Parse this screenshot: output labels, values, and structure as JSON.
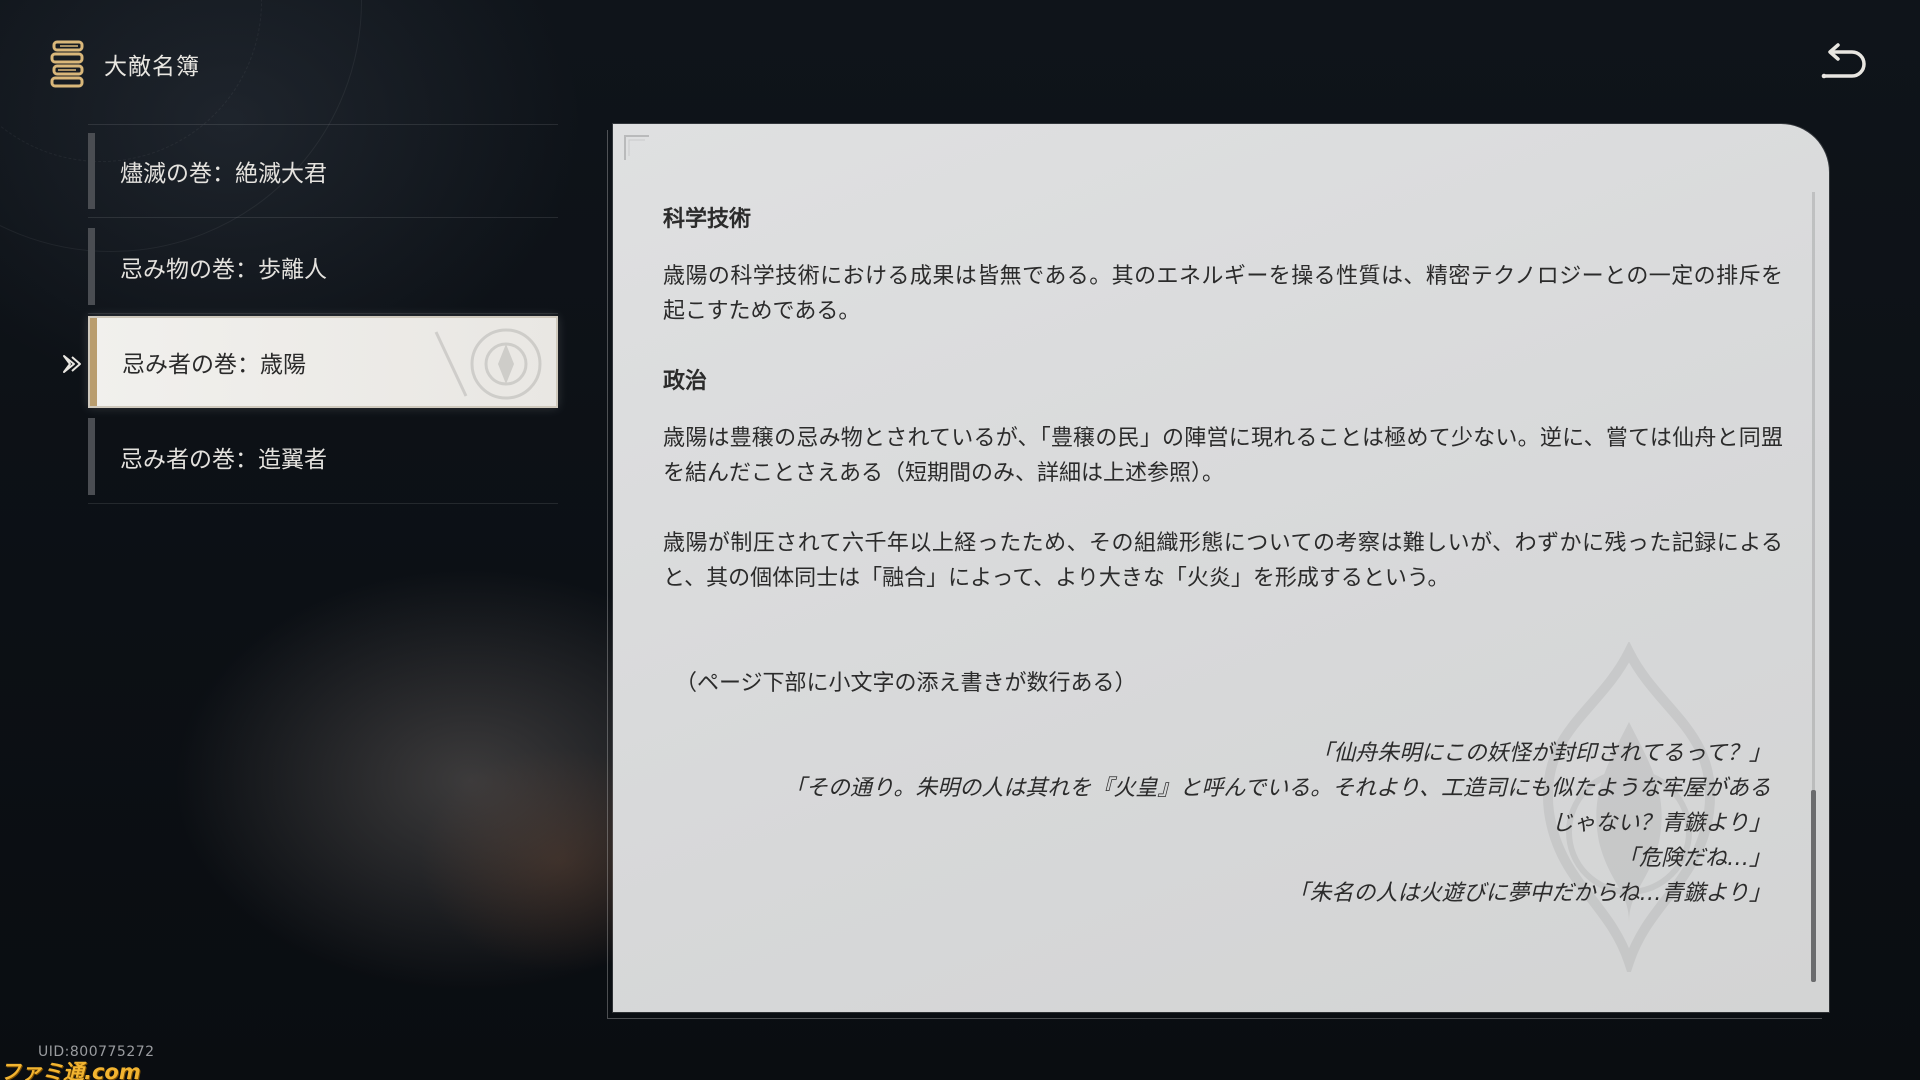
{
  "header": {
    "title": "大敵名簿",
    "book_icon": "book-icon",
    "back_icon": "back-arrow-icon"
  },
  "sidebar": {
    "items": [
      {
        "label": "燼滅の巻：絶滅大君",
        "active": false
      },
      {
        "label": "忌み物の巻：歩離人",
        "active": false
      },
      {
        "label": "忌み者の巻：歳陽",
        "active": true
      },
      {
        "label": "忌み者の巻：造翼者",
        "active": false
      }
    ]
  },
  "content": {
    "sections": [
      {
        "heading": "科学技術",
        "paragraphs": [
          "歳陽の科学技術における成果は皆無である。其のエネルギーを操る性質は、精密テクノロジーとの一定の排斥を起こすためである。"
        ]
      },
      {
        "heading": "政治",
        "paragraphs": [
          "歳陽は豊穣の忌み物とされているが、「豊穣の民」の陣営に現れることは極めて少ない。逆に、嘗ては仙舟と同盟を結んだことさえある（短期間のみ、詳細は上述参照）。",
          "歳陽が制圧されて六千年以上経ったため、その組織形態についての考察は難しいが、わずかに残った記録によると、其の個体同士は「融合」によって、より大きな「火炎」を形成するという。"
        ]
      }
    ],
    "aside": "（ページ下部に小文字の添え書きが数行ある）",
    "quotes": [
      "「仙舟朱明にこの妖怪が封印されてるって？」",
      "「その通り。朱明の人は其れを『火皇』と呼んでいる。それより、工造司にも似たような牢屋がある",
      "じゃない？青鏃より」",
      "「危険だね…」",
      "「朱名の人は火遊びに夢中だからね…青鏃より」"
    ],
    "scroll_position": 0.78
  },
  "footer": {
    "uid": "UID:800775272",
    "watermark": "ファミ通.com"
  },
  "colors": {
    "accent_gold": "#b99d6e",
    "panel_bg": "#dcdddd",
    "screen_bg": "#0b0e12"
  }
}
